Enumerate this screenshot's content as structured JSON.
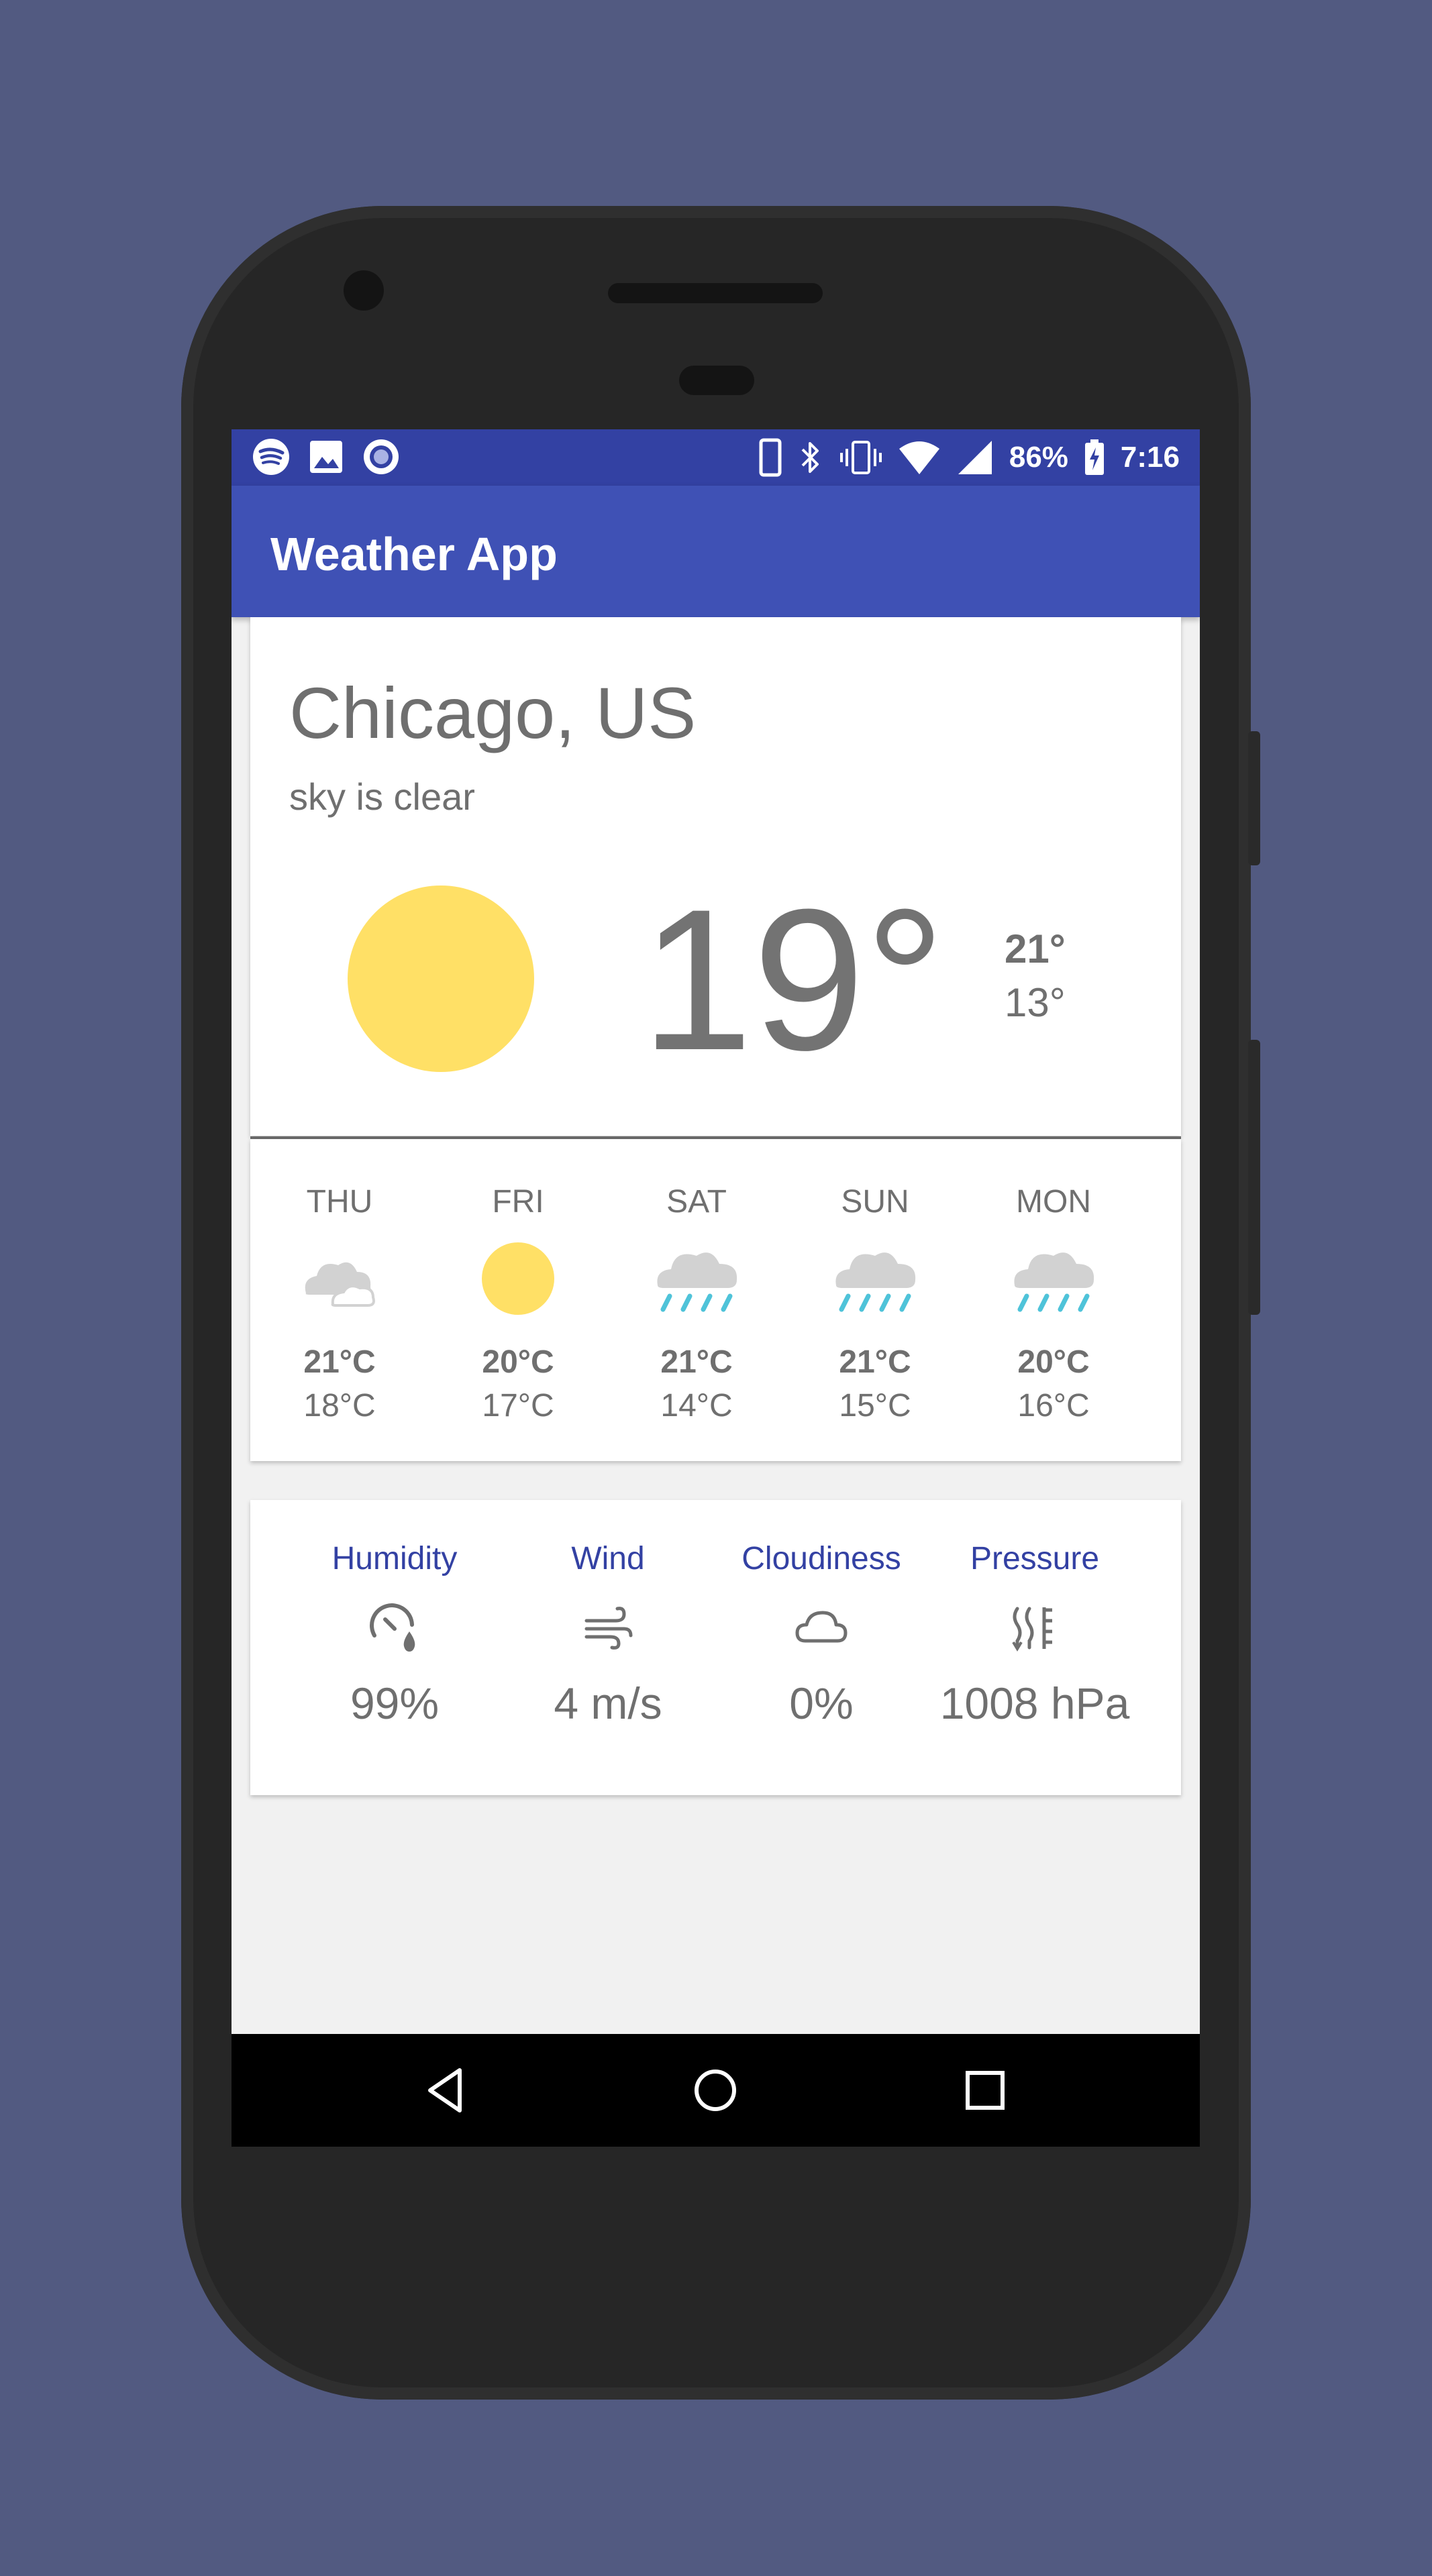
{
  "status_bar": {
    "battery": "86%",
    "time": "7:16",
    "left_icons": [
      "spotify-icon",
      "image-icon",
      "record-icon"
    ],
    "right_icons": [
      "phone-icon",
      "bluetooth-icon",
      "vibrate-icon",
      "wifi-icon",
      "signal-icon",
      "battery-charging-icon"
    ]
  },
  "app_bar": {
    "title": "Weather App"
  },
  "current": {
    "city": "Chicago, US",
    "description": "sky is clear",
    "temperature": "19°",
    "temp_max": "21°",
    "temp_min": "13°",
    "icon": "sun-icon"
  },
  "forecast": [
    {
      "day": "THU",
      "icon": "cloudy-icon",
      "max": "21°C",
      "min": "18°C"
    },
    {
      "day": "FRI",
      "icon": "sun-icon",
      "max": "20°C",
      "min": "17°C"
    },
    {
      "day": "SAT",
      "icon": "rain-icon",
      "max": "21°C",
      "min": "14°C"
    },
    {
      "day": "SUN",
      "icon": "rain-icon",
      "max": "21°C",
      "min": "15°C"
    },
    {
      "day": "MON",
      "icon": "rain-icon",
      "max": "20°C",
      "min": "16°C"
    }
  ],
  "details": [
    {
      "label": "Humidity",
      "icon": "humidity-icon",
      "value": "99%"
    },
    {
      "label": "Wind",
      "icon": "wind-icon",
      "value": "4 m/s"
    },
    {
      "label": "Cloudiness",
      "icon": "cloud-icon",
      "value": "0%"
    },
    {
      "label": "Pressure",
      "icon": "pressure-icon",
      "value": "1008 hPa"
    }
  ],
  "colors": {
    "primary": "#3f51b5",
    "primary_dark": "#3341a3",
    "sun": "#ffe066",
    "rain": "#4fc3d9",
    "background": "#525a81"
  }
}
